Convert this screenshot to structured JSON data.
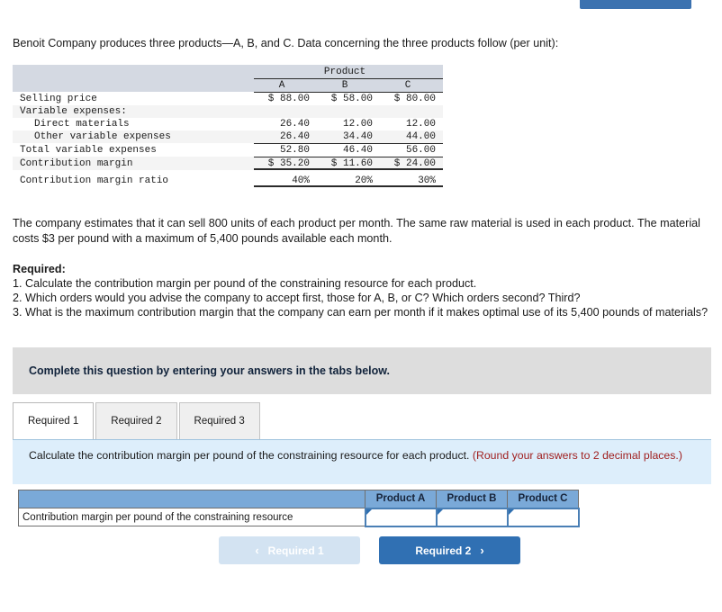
{
  "top_button": {
    "label": ""
  },
  "intro": "Benoit Company produces three products—A, B, and C. Data concerning the three products follow (per unit):",
  "data_table": {
    "group_header": "Product",
    "columns": [
      "A",
      "B",
      "C"
    ],
    "rows": [
      {
        "label": "Selling price",
        "indent": false,
        "values": [
          "$ 88.00",
          "$ 58.00",
          "$ 80.00"
        ]
      },
      {
        "label": "Variable expenses:",
        "indent": false,
        "values": [
          "",
          "",
          ""
        ]
      },
      {
        "label": "Direct materials",
        "indent": true,
        "values": [
          "26.40",
          "12.00",
          "12.00"
        ]
      },
      {
        "label": "Other variable expenses",
        "indent": true,
        "values": [
          "26.40",
          "34.40",
          "44.00"
        ]
      },
      {
        "label": "Total variable expenses",
        "indent": false,
        "values": [
          "52.80",
          "46.40",
          "56.00"
        ]
      },
      {
        "label": "Contribution margin",
        "indent": false,
        "values": [
          "$ 35.20",
          "$ 11.60",
          "$ 24.00"
        ]
      },
      {
        "label": "Contribution margin ratio",
        "indent": false,
        "values": [
          "40%",
          "20%",
          "30%"
        ]
      }
    ]
  },
  "paragraph": "The company estimates that it can sell 800 units of each product per month. The same raw material is used in each product. The material costs $3 per pound with a maximum of 5,400 pounds available each month.",
  "required": {
    "heading": "Required:",
    "items": [
      "1. Calculate the contribution margin per pound of the constraining resource for each product.",
      "2. Which orders would you advise the company to accept first, those for A, B, or C? Which orders second? Third?",
      "3. What is the maximum contribution margin that the company can earn per month if it makes optimal use of its 5,400 pounds of materials?"
    ]
  },
  "banner": {
    "text": "Complete this question by entering your answers in the tabs below."
  },
  "tabs": [
    {
      "label": "Required 1",
      "active": true
    },
    {
      "label": "Required 2",
      "active": false
    },
    {
      "label": "Required 3",
      "active": false
    }
  ],
  "requirement_panel": {
    "prompt": "Calculate the contribution margin per pound of the constraining resource for each product.",
    "note": "(Round your answers to 2 decimal places.)"
  },
  "answer_table": {
    "headers": [
      "",
      "Product A",
      "Product B",
      "Product C"
    ],
    "row_label": "Contribution margin per pound of the constraining resource",
    "values": [
      "",
      "",
      ""
    ]
  },
  "nav": {
    "prev_label": "Required 1",
    "next_label": "Required 2",
    "prev_chevron": "‹",
    "next_chevron": "›"
  }
}
